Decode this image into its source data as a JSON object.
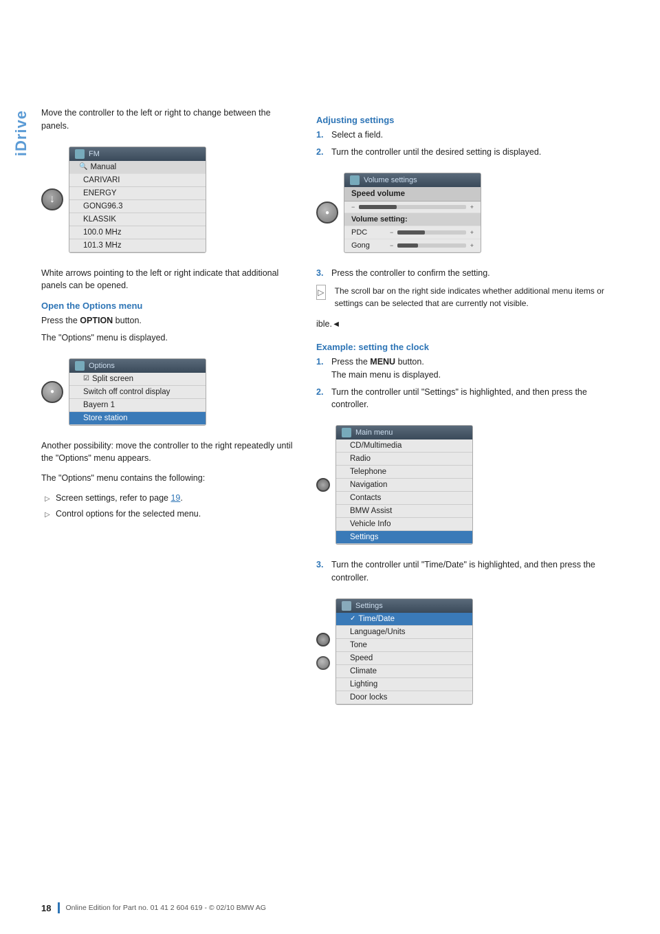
{
  "sidebar": {
    "label": "iDrive"
  },
  "left_col": {
    "intro_text": "Move the controller to the left or right to change between the panels.",
    "white_arrows_text": "White arrows pointing to the left or right indicate that additional panels can be opened.",
    "options_section": {
      "heading": "Open the Options menu",
      "step1": "Press the OPTION button.",
      "step2": "The \"Options\" menu is displayed.",
      "another_possibility": "Another possibility: move the controller to the right repeatedly until the \"Options\" menu appears.",
      "contains_text": "The \"Options\" menu contains the following:",
      "bullet1": "Screen settings, refer to page 19.",
      "bullet1_link": "19",
      "bullet2": "Control options for the selected menu."
    },
    "fm_screen": {
      "header": "FM",
      "items": [
        "Manual",
        "CARIVARI",
        "ENERGY",
        "GONG96.3",
        "KLASSIK",
        "100.0 MHz",
        "101.3 MHz"
      ]
    },
    "options_screen": {
      "header": "Options",
      "items": [
        {
          "label": "Split screen",
          "icon": true,
          "selected": false
        },
        {
          "label": "Switch off control display",
          "selected": false
        },
        {
          "label": "Bayern 1",
          "selected": false
        },
        {
          "label": "Store station",
          "selected": true
        }
      ]
    }
  },
  "right_col": {
    "adjusting_section": {
      "heading": "Adjusting settings",
      "step1": "Select a field.",
      "step2": "Turn the controller until the desired setting is displayed.",
      "step3": "Press the controller to confirm the setting.",
      "scroll_note": "The scroll bar on the right side indicates whether additional menu items or settings can be selected that are currently not visible.",
      "back_ref": "ible.◄"
    },
    "volume_screen": {
      "header": "Volume settings",
      "speed_volume_label": "Speed volume",
      "items": [
        {
          "label": "Volume setting:",
          "sublabel": ""
        },
        {
          "label": "PDC",
          "bar": 40
        },
        {
          "label": "Gong",
          "bar": 30
        }
      ]
    },
    "example_section": {
      "heading": "Example: setting the clock",
      "step1_a": "Press the MENU button.",
      "step1_b": "The main menu is displayed.",
      "step2": "Turn the controller until \"Settings\" is highlighted, and then press the controller.",
      "step3": "Turn the controller until \"Time/Date\" is highlighted, and then press the controller."
    },
    "main_menu_screen": {
      "header": "Main menu",
      "items": [
        {
          "label": "CD/Multimedia",
          "selected": false
        },
        {
          "label": "Radio",
          "selected": false
        },
        {
          "label": "Telephone",
          "selected": false
        },
        {
          "label": "Navigation",
          "selected": false
        },
        {
          "label": "Contacts",
          "selected": false
        },
        {
          "label": "BMW Assist",
          "selected": false
        },
        {
          "label": "Vehicle Info",
          "selected": false
        },
        {
          "label": "Settings",
          "selected": true
        }
      ]
    },
    "settings_screen": {
      "header": "Settings",
      "items": [
        {
          "label": "Time/Date",
          "selected": true,
          "check": true
        },
        {
          "label": "Language/Units",
          "selected": false
        },
        {
          "label": "Tone",
          "selected": false
        },
        {
          "label": "Speed",
          "selected": false
        },
        {
          "label": "Climate",
          "selected": false
        },
        {
          "label": "Lighting",
          "selected": false
        },
        {
          "label": "Door locks",
          "selected": false
        }
      ]
    }
  },
  "footer": {
    "page_number": "18",
    "copyright_text": "Online Edition for Part no. 01 41 2 604 619 - © 02/10 BMW AG"
  }
}
